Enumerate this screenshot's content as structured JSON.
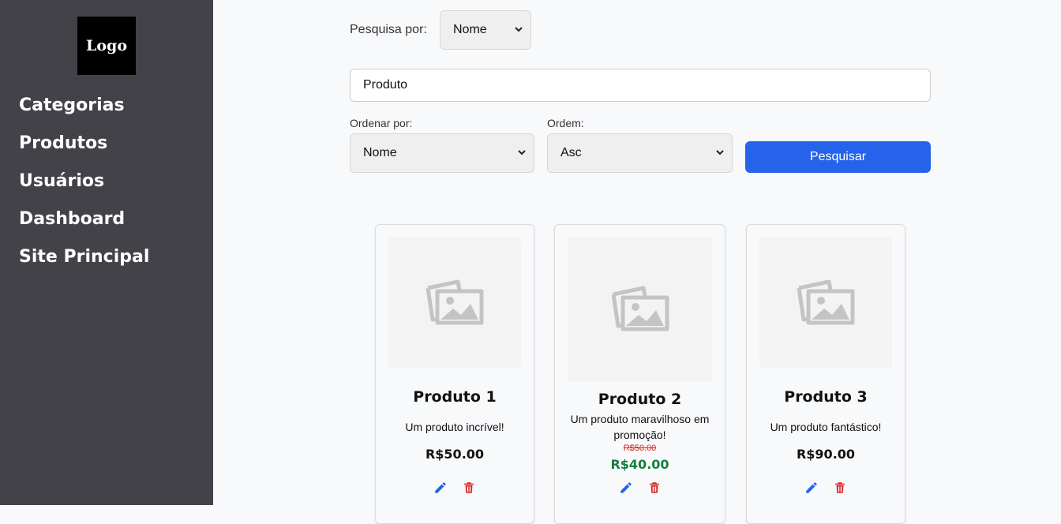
{
  "sidebar": {
    "logo_text": "Logo",
    "items": [
      {
        "label": "Categorias"
      },
      {
        "label": "Produtos"
      },
      {
        "label": "Usuários"
      },
      {
        "label": "Dashboard"
      },
      {
        "label": "Site Principal"
      }
    ]
  },
  "search": {
    "type_label": "Pesquisa por:",
    "type_value": "Nome",
    "query_value": "Produto",
    "order_by_label": "Ordenar por:",
    "order_by_value": "Nome",
    "order_label": "Ordem:",
    "order_value": "Asc",
    "button_label": "Pesquisar"
  },
  "products": [
    {
      "name": "Produto 1",
      "description": "Um produto incrível!",
      "price": "R$50.00",
      "edit_icon": "pencil-icon",
      "delete_icon": "trash-icon"
    },
    {
      "name": "Produto 2",
      "description": "Um produto maravilhoso em promoção!",
      "old_price": "R$50.00",
      "price": "R$40.00",
      "edit_icon": "pencil-icon",
      "delete_icon": "trash-icon"
    },
    {
      "name": "Produto 3",
      "description": "Um produto fantástico!",
      "price": "R$90.00",
      "edit_icon": "pencil-icon",
      "delete_icon": "trash-icon"
    }
  ],
  "colors": {
    "sidebar_bg": "#434249",
    "primary": "#2563eb",
    "promo_price": "#15803d",
    "old_price": "#dc2626",
    "delete": "#dc2626",
    "edit": "#2563eb"
  }
}
